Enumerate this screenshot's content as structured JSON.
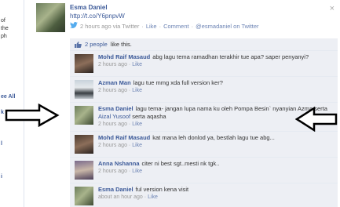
{
  "sidebar_fragments": [
    {
      "text": "of"
    },
    {
      "text": "the"
    },
    {
      "text": "ph"
    },
    {
      "text": "ee All",
      "link": true
    },
    {
      "text": "k",
      "link": true
    },
    {
      "text": "l",
      "link": true
    },
    {
      "text": "i",
      "link": true
    }
  ],
  "post": {
    "author": "Esma Daniel",
    "link": "http://t.co/Y6pnpvW",
    "time": "2 hours ago via Twitter",
    "like": "Like",
    "comment": "Comment",
    "source": "@esmadaniel on Twitter",
    "separator": "·",
    "close": "×"
  },
  "likes": {
    "count_text": "2 people",
    "suffix": "like this."
  },
  "comments": [
    {
      "name": "Mohd Raif Masaud",
      "text": "abg lagu tema ramadhan terakhir tue apa? saper penyanyi?",
      "time": "2 hours ago",
      "like": "Like",
      "avatar": "man"
    },
    {
      "name": "Azman Man",
      "text": "lagu tue mmg xda full version ker?",
      "time": "2 hours ago",
      "like": "Like",
      "avatar": "car"
    },
    {
      "name": "Esma Daniel",
      "text_before": "lagu tema- jangan lupa nama ku oleh Pompa Besin` nyanyian Azma serta",
      "mention": "Aizal Yusoof",
      "text_after": "serta aqasha",
      "time": "2 hours ago",
      "like": "Like",
      "avatar": "group"
    },
    {
      "name": "Mohd Raif Masaud",
      "text": "kat mana leh donlod ya, bestlah lagu tue abg...",
      "time": "2 hours ago",
      "like": "Like",
      "avatar": "man"
    },
    {
      "name": "Anna Nshanna",
      "text": "citer ni best sgt..mesti nk tgk..",
      "time": "2 hours ago",
      "like": "Like",
      "avatar": "girl"
    },
    {
      "name": "Esma Daniel",
      "text": "ful version kena visit",
      "time": "about an hour ago",
      "like": "Like",
      "avatar": "group"
    }
  ],
  "colors": {
    "link": "#3b5998",
    "comment_bg": "#edeff4",
    "meta": "#999999"
  },
  "icons": {
    "post_source": "twitter-bird-icon",
    "likes": "thumbs-up-icon",
    "arrows": [
      "right-arrow",
      "left-arrow"
    ]
  }
}
